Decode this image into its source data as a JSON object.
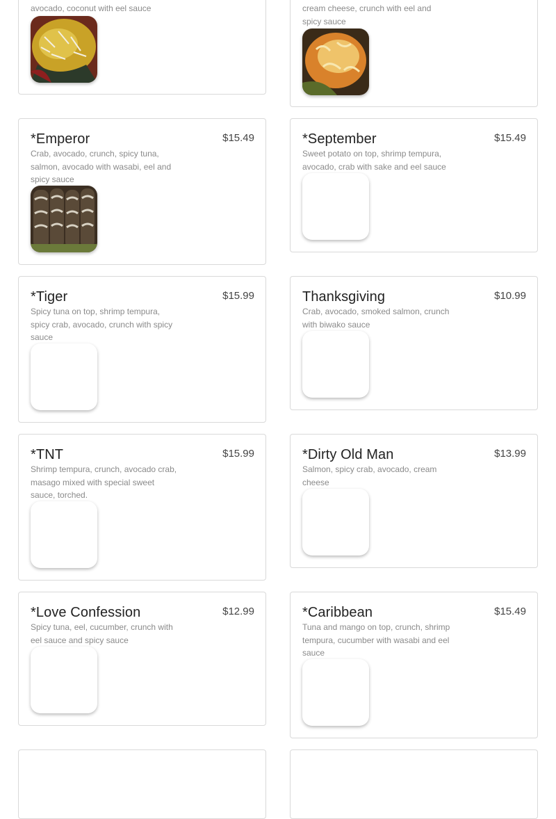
{
  "menu_items": [
    {
      "id": "top-left",
      "title": "",
      "price": "",
      "desc": "avocado, coconut with eel sauce",
      "has_photo": true
    },
    {
      "id": "top-right",
      "title": "",
      "price": "",
      "desc": "cream cheese, crunch with eel and spicy sauce",
      "has_photo": true
    },
    {
      "id": "emperor",
      "title": "*Emperor",
      "price": "$15.49",
      "desc": "Crab, avocado, crunch, spicy tuna, salmon, avocado with wasabi, eel and spicy sauce",
      "has_photo": true
    },
    {
      "id": "september",
      "title": "*September",
      "price": "$15.49",
      "desc": "Sweet potato on top, shrimp tempura, avocado, crab with sake and eel sauce",
      "has_photo": false
    },
    {
      "id": "tiger",
      "title": "*Tiger",
      "price": "$15.99",
      "desc": "Spicy tuna on top, shrimp tempura, spicy crab, avocado, crunch with spicy sauce",
      "has_photo": false
    },
    {
      "id": "thanksgiving",
      "title": "Thanksgiving",
      "price": "$10.99",
      "desc": "Crab, avocado, smoked salmon, crunch with biwako sauce",
      "has_photo": false
    },
    {
      "id": "tnt",
      "title": "*TNT",
      "price": "$15.99",
      "desc": "Shrimp tempura, crunch, avocado crab, masago mixed with special sweet sauce, torched.",
      "has_photo": false
    },
    {
      "id": "dirty-old-man",
      "title": "*Dirty Old Man",
      "price": "$13.99",
      "desc": "Salmon, spicy crab, avocado, cream cheese",
      "has_photo": false
    },
    {
      "id": "love-confession",
      "title": "*Love Confession",
      "price": "$12.99",
      "desc": "Spicy tuna, eel, cucumber, crunch with eel sauce and spicy sauce",
      "has_photo": false
    },
    {
      "id": "caribbean",
      "title": "*Caribbean",
      "price": "$15.49",
      "desc": "Tuna and mango on top, crunch, shrimp tempura, cucumber with wasabi and eel sauce",
      "has_photo": false
    }
  ],
  "colors": {
    "card_border": "#d9d9d9",
    "title": "#222222",
    "desc": "#8a8a8a",
    "price": "#444444"
  }
}
